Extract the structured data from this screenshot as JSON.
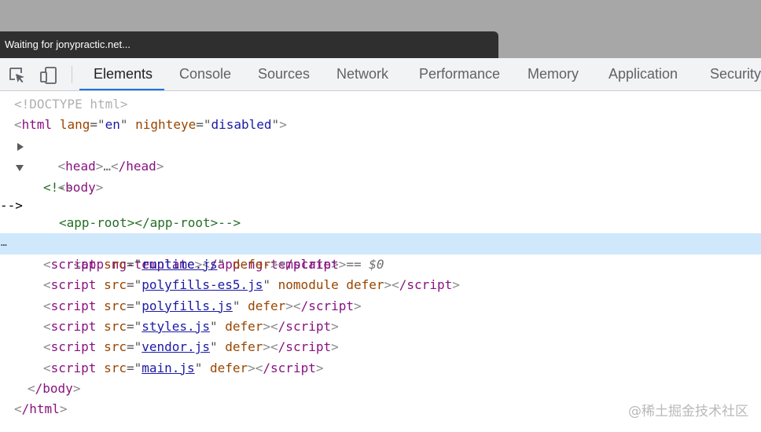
{
  "status_bar": {
    "text": "Waiting for jonypractic.net..."
  },
  "toolbar": {
    "inspect_icon": "inspect-element-icon",
    "device_icon": "device-toolbar-icon",
    "tabs": [
      {
        "label": "Elements",
        "active": true
      },
      {
        "label": "Console"
      },
      {
        "label": "Sources"
      },
      {
        "label": "Network"
      },
      {
        "label": "Performance"
      },
      {
        "label": "Memory"
      },
      {
        "label": "Application"
      },
      {
        "label": "Security"
      }
    ]
  },
  "dom": {
    "doctype": "<!DOCTYPE html>",
    "html_open": {
      "tag": "html",
      "attr1": "lang",
      "val1": "en",
      "attr2": "nighteye",
      "val2": "disabled"
    },
    "head": {
      "open": "head",
      "ellipsis": "…",
      "close": "/head"
    },
    "body_open": "body",
    "comment_open": "<!--",
    "comment_body": "<app-root></app-root>-->",
    "selected": {
      "open": "app-ng-template",
      "close": "/app-ng-template",
      "marker": "== $0",
      "dots": "…"
    },
    "scripts": [
      {
        "src": "runtime.js",
        "extra": "defer"
      },
      {
        "src": "polyfills-es5.js",
        "extra": "nomodule defer"
      },
      {
        "src": "polyfills.js",
        "extra": "defer"
      },
      {
        "src": "styles.js",
        "extra": "defer"
      },
      {
        "src": "vendor.js",
        "extra": "defer"
      },
      {
        "src": "main.js",
        "extra": "defer"
      }
    ],
    "script_tag": "script",
    "script_close": "/script",
    "src_attr": "src",
    "body_close": "/body",
    "html_close": "/html"
  },
  "watermark": "@稀土掘金技术社区",
  "colors": {
    "accent": "#1a73e8",
    "selected_row": "#cfe8fc",
    "tag": "#881280",
    "attr": "#994500",
    "value": "#1a1aa6",
    "comment": "#236e25"
  }
}
